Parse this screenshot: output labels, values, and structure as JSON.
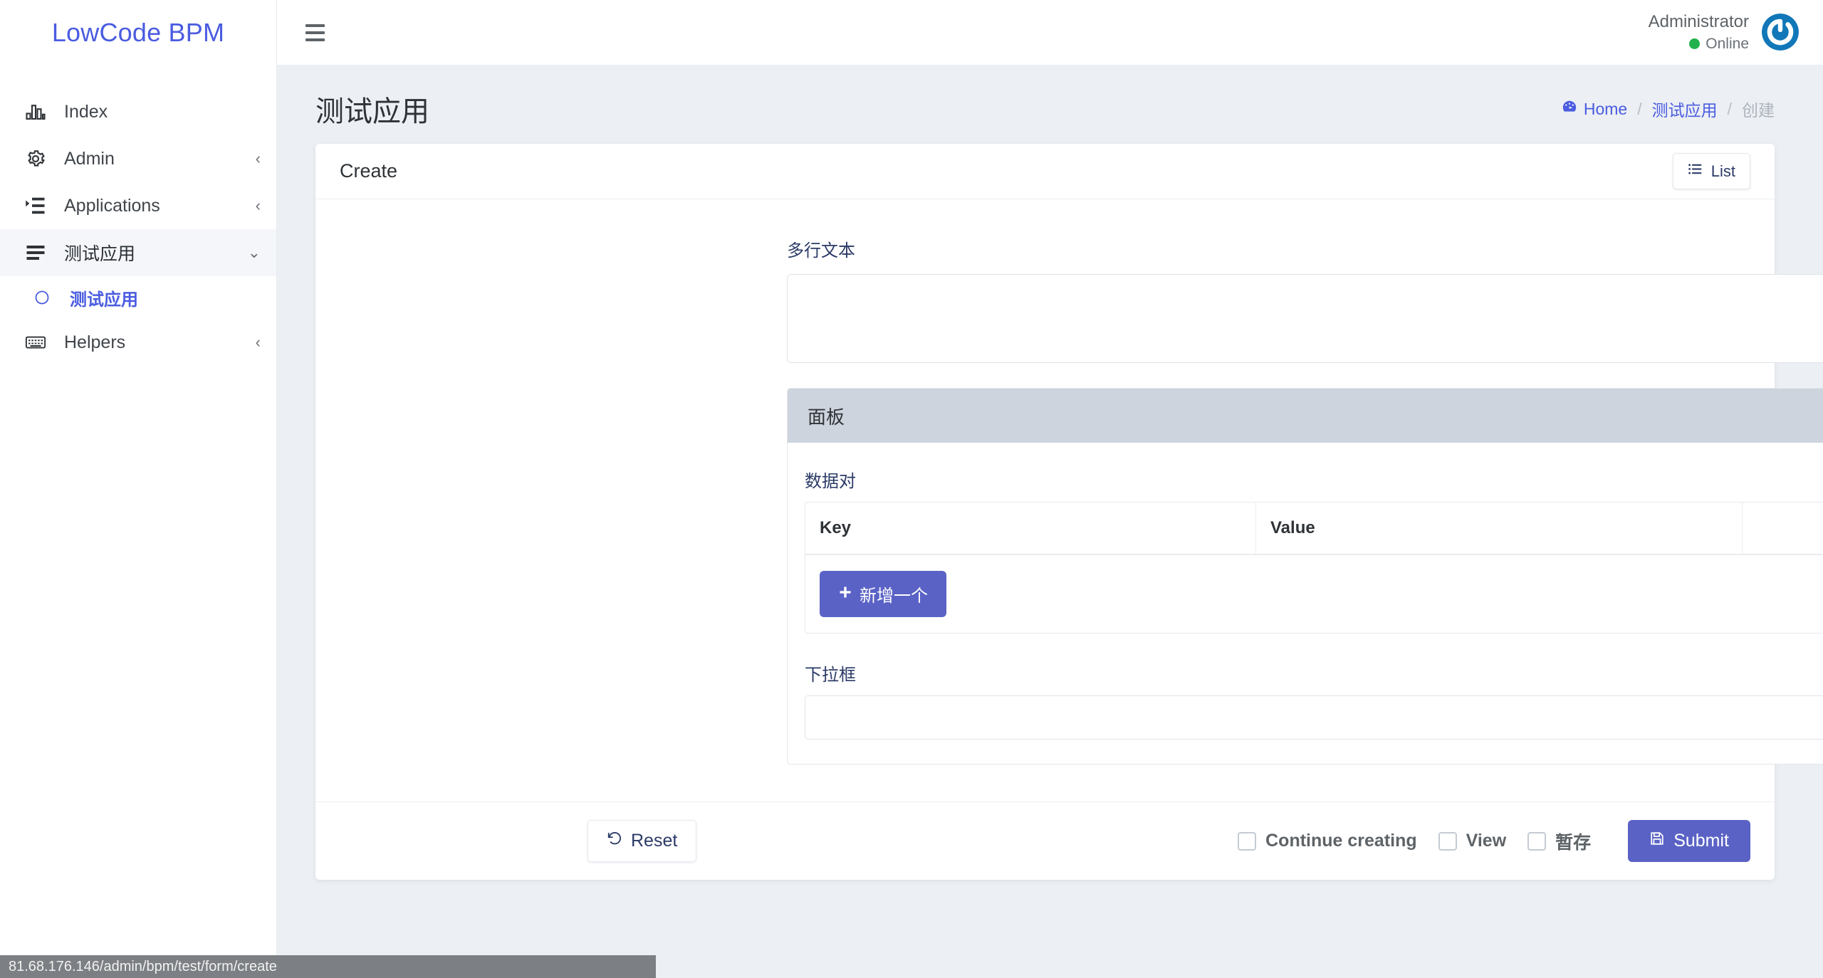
{
  "brand": {
    "name": "LowCode BPM"
  },
  "sidebar": {
    "items": [
      {
        "label": "Index",
        "icon": "chart-bar-icon",
        "caret": ""
      },
      {
        "label": "Admin",
        "icon": "gear-icon",
        "caret": "‹"
      },
      {
        "label": "Applications",
        "icon": "list-indent-icon",
        "caret": "‹"
      },
      {
        "label": "测试应用",
        "icon": "bars-icon",
        "caret": "⌄"
      },
      {
        "label": "Helpers",
        "icon": "keyboard-icon",
        "caret": "‹"
      }
    ],
    "sub_item": {
      "label": "测试应用",
      "icon": "circle-icon"
    }
  },
  "topbar": {
    "menu_icon": "hamburger-icon",
    "user_name": "Administrator",
    "user_status": "Online",
    "status_color": "#22b14c",
    "avatar_icon": "power-logo-avatar"
  },
  "page": {
    "title": "测试应用",
    "breadcrumb": {
      "home_icon": "dashboard-icon",
      "home": "Home",
      "sep1": "/",
      "app": "测试应用",
      "sep2": "/",
      "current": "创建"
    }
  },
  "card": {
    "title": "Create",
    "list_button": {
      "label": "List",
      "icon": "list-icon"
    }
  },
  "form": {
    "multiline": {
      "label": "多行文本",
      "value": "",
      "placeholder": ""
    },
    "panel": {
      "title": "面板",
      "data_pair": {
        "label": "数据对",
        "columns": [
          "Key",
          "Value",
          ""
        ],
        "rows": [],
        "add_button": {
          "label": "新增一个",
          "icon": "plus-icon"
        }
      },
      "select": {
        "label": "下拉框",
        "value": "",
        "options": []
      }
    }
  },
  "footer": {
    "reset": {
      "label": "Reset",
      "icon": "rotate-left-icon"
    },
    "checkboxes": [
      {
        "label": "Continue creating",
        "checked": false
      },
      {
        "label": "View",
        "checked": false
      },
      {
        "label": "暂存",
        "checked": false
      }
    ],
    "submit": {
      "label": "Submit",
      "icon": "save-icon"
    }
  },
  "statusbar": {
    "url": "81.68.176.146/admin/bpm/test/form/create"
  },
  "colors": {
    "accent": "#4a5ce0",
    "button": "#5a62c5",
    "page_bg": "#eceff4",
    "panel_head": "#ced4de",
    "online": "#22b14c"
  }
}
